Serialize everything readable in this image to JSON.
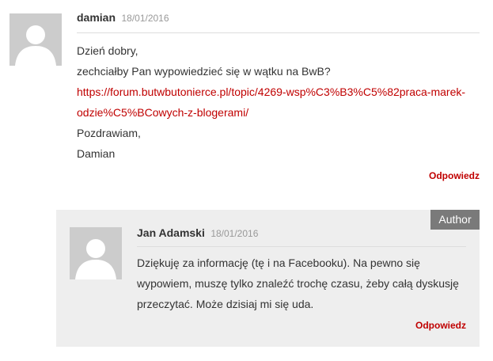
{
  "comment1": {
    "author": "damian",
    "date": "18/01/2016",
    "lines": {
      "greeting": "Dzień dobry,",
      "question": "zechciałby Pan wypowiedzieć się w wątku na BwB?",
      "link_line1": "https://forum.butwbutonierce.pl/topic/4269-wsp%C3%B3%C5%82praca-marek-",
      "link_line2": "odzie%C5%BCowych-z-blogerami/",
      "signoff": "Pozdrawiam,",
      "signature": "Damian"
    },
    "reply_label": "Odpowiedz",
    "avatar_icon": "default-user-icon"
  },
  "comment2": {
    "badge": "Author",
    "author": "Jan Adamski",
    "date": "18/01/2016",
    "lines": {
      "line1": "Dziękuję za informację (tę i na Facebooku). Na pewno się",
      "line2": "wypowiem, muszę tylko znaleźć trochę czasu, żeby całą dyskusję",
      "line3": "przeczytać. Może dzisiaj mi się uda."
    },
    "reply_label": "Odpowiedz",
    "avatar_icon": "default-user-icon"
  },
  "colors": {
    "link": "#c00000",
    "badge_bg": "#7a7a7a",
    "child_bg": "#eeeeee",
    "avatar_bg": "#cccccc"
  }
}
